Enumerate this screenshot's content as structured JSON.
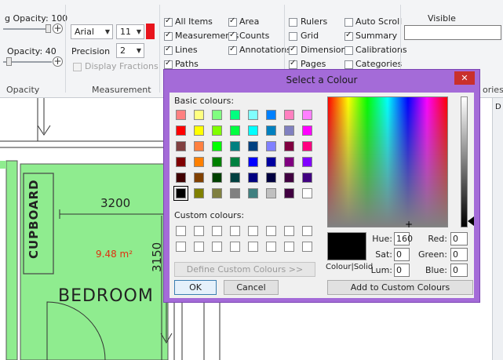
{
  "ribbon": {
    "opacity_group": {
      "label": "Opacity",
      "top_slider_label": "g Opacity: 100",
      "bottom_slider_label": "Opacity: 40",
      "top_value": 100,
      "bottom_value": 40
    },
    "measurement_group": {
      "label": "Measurement",
      "font": "Arial",
      "font_size": "11",
      "color": "#e8141c",
      "precision_label": "Precision",
      "precision_value": "2",
      "display_fractions_label": "Display Fractions"
    },
    "items_group": {
      "all_items": "All Items",
      "area": "Area",
      "measurements": "Measurements",
      "counts": "Counts",
      "lines": "Lines",
      "annotations": "Annotations",
      "paths": "Paths"
    },
    "view_group": {
      "rulers": "Rulers",
      "auto_scroll": "Auto Scroll",
      "grid": "Grid",
      "summary": "Summary",
      "dimensions": "Dimensions",
      "calibrations": "Calibrations",
      "pages": "Pages",
      "categories": "Categories",
      "partial_label": "ories"
    },
    "visible_categories": {
      "label": "Visible Categories",
      "value": ""
    }
  },
  "drawing": {
    "room_label": "BEDROOM",
    "cupboard_label": "CUPBOARD",
    "width_dim": "3200",
    "height_dim": "3150",
    "area": "9.48 m²",
    "fill_color": "#8fec8f"
  },
  "right_pane": {
    "partial_label": "D"
  },
  "dialog": {
    "title": "Select a Colour",
    "close_icon": "close-icon",
    "basic_colours_label": "Basic colours:",
    "custom_colours_label": "Custom colours:",
    "define_custom_label": "Define Custom Colours >>",
    "ok_label": "OK",
    "cancel_label": "Cancel",
    "add_custom_label": "Add to Custom Colours",
    "colour_solid_label": "Colour|Solid",
    "hue_label": "Hue:",
    "sat_label": "Sat:",
    "lum_label": "Lum:",
    "red_label": "Red:",
    "green_label": "Green:",
    "blue_label": "Blue:",
    "hue": "160",
    "sat": "0",
    "lum": "0",
    "red": "0",
    "green": "0",
    "blue": "0",
    "current_colour": "#000000",
    "basic_colours": [
      [
        "#ff8080",
        "#ffff80",
        "#80ff80",
        "#00ff80",
        "#80ffff",
        "#0080ff",
        "#ff80c0",
        "#ff80ff"
      ],
      [
        "#ff0000",
        "#ffff00",
        "#80ff00",
        "#00ff40",
        "#00ffff",
        "#0080c0",
        "#8080c0",
        "#ff00ff"
      ],
      [
        "#804040",
        "#ff8040",
        "#00ff00",
        "#008080",
        "#004080",
        "#8080ff",
        "#800040",
        "#ff0080"
      ],
      [
        "#800000",
        "#ff8000",
        "#008000",
        "#008040",
        "#0000ff",
        "#0000a0",
        "#800080",
        "#8000ff"
      ],
      [
        "#400000",
        "#804000",
        "#004000",
        "#004040",
        "#000080",
        "#000040",
        "#400040",
        "#400080"
      ],
      [
        "#000000",
        "#808000",
        "#808040",
        "#808080",
        "#408080",
        "#c0c0c0",
        "#400040",
        "#ffffff"
      ]
    ],
    "selected_basic": [
      5,
      0
    ]
  }
}
